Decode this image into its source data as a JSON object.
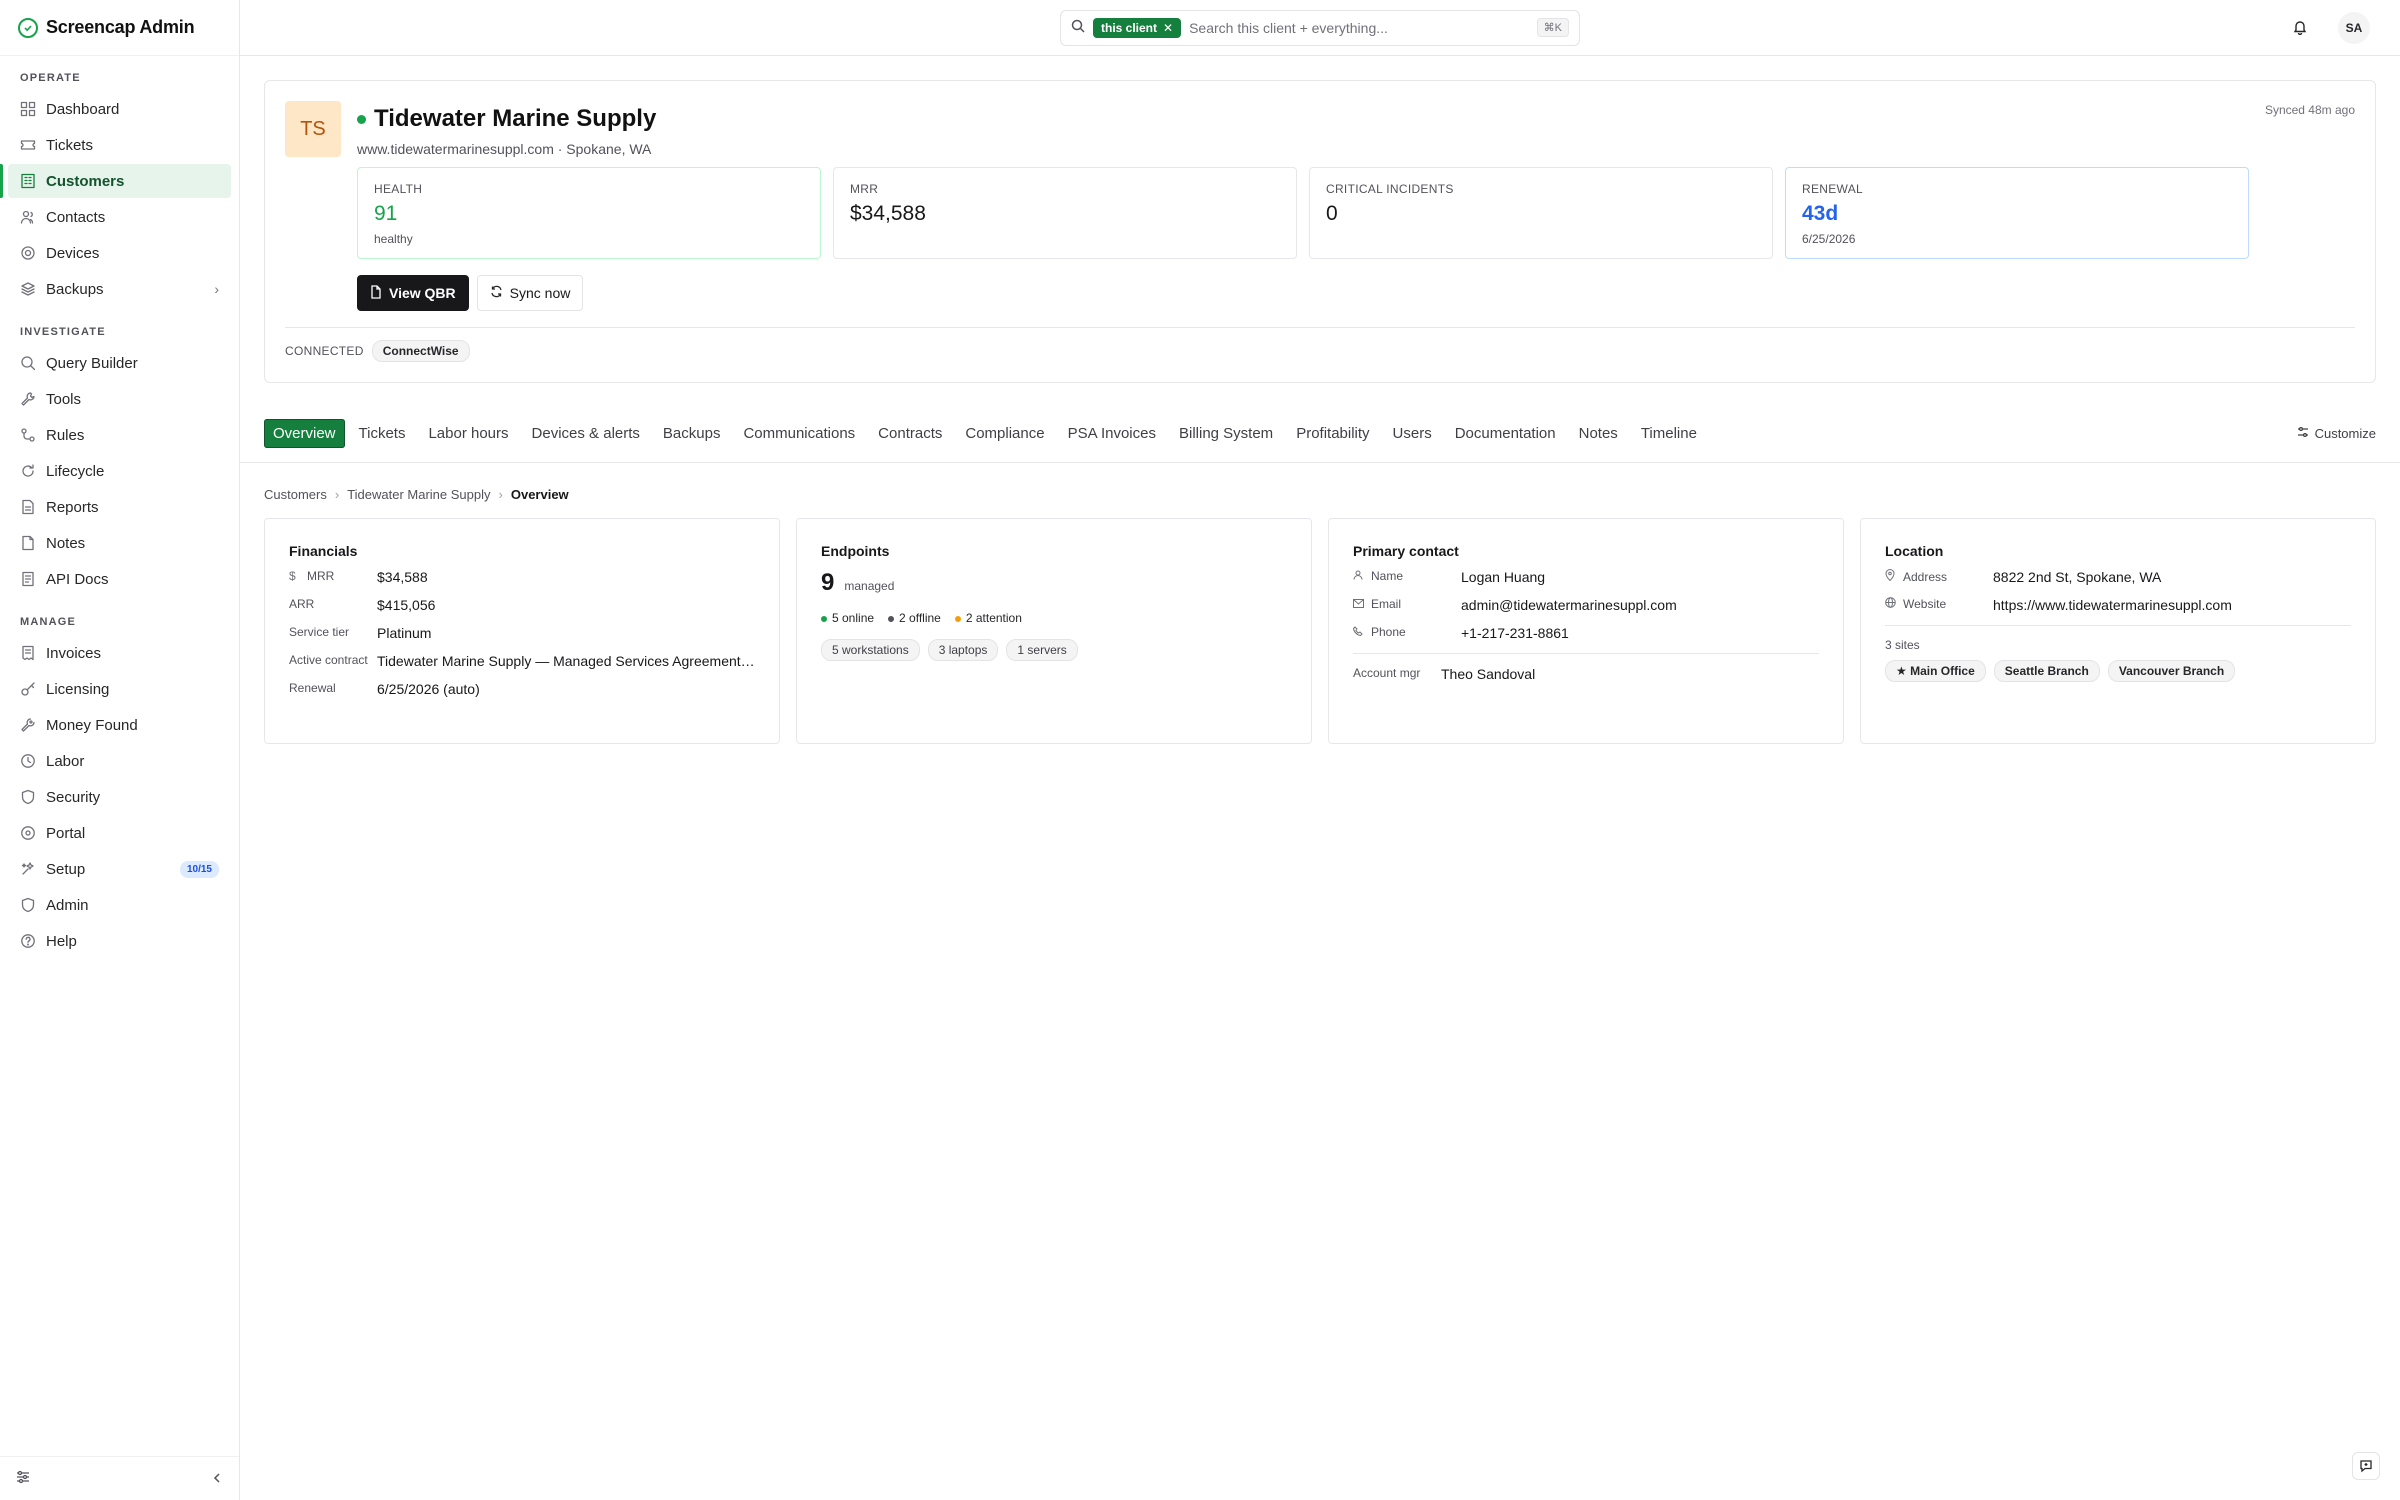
{
  "app": {
    "name": "Screencap Admin"
  },
  "sidebar": {
    "sections": [
      {
        "title": "OPERATE",
        "items": [
          {
            "label": "Dashboard",
            "icon": "dashboard-icon"
          },
          {
            "label": "Tickets",
            "icon": "ticket-icon"
          },
          {
            "label": "Customers",
            "icon": "building-icon",
            "active": true
          },
          {
            "label": "Contacts",
            "icon": "contacts-icon"
          },
          {
            "label": "Devices",
            "icon": "devices-icon"
          },
          {
            "label": "Backups",
            "icon": "backup-icon",
            "expandable": true
          }
        ]
      },
      {
        "title": "INVESTIGATE",
        "items": [
          {
            "label": "Query Builder",
            "icon": "search-icon"
          },
          {
            "label": "Tools",
            "icon": "wrench-icon"
          },
          {
            "label": "Rules",
            "icon": "rules-icon"
          },
          {
            "label": "Lifecycle",
            "icon": "lifecycle-icon"
          },
          {
            "label": "Reports",
            "icon": "report-icon"
          },
          {
            "label": "Notes",
            "icon": "note-icon"
          },
          {
            "label": "API Docs",
            "icon": "doc-icon"
          }
        ]
      },
      {
        "title": "MANAGE",
        "items": [
          {
            "label": "Invoices",
            "icon": "invoice-icon"
          },
          {
            "label": "Licensing",
            "icon": "key-icon"
          },
          {
            "label": "Money Found",
            "icon": "money-icon"
          },
          {
            "label": "Labor",
            "icon": "clock-icon"
          },
          {
            "label": "Security",
            "icon": "shield-icon"
          },
          {
            "label": "Portal",
            "icon": "portal-icon"
          },
          {
            "label": "Setup",
            "icon": "setup-icon",
            "badge": "10/15"
          },
          {
            "label": "Admin",
            "icon": "admin-shield-icon"
          },
          {
            "label": "Help",
            "icon": "help-icon"
          }
        ]
      }
    ]
  },
  "topbar": {
    "scope_chip": "this client",
    "search_placeholder": "Search this client + everything...",
    "shortcut": "⌘K",
    "user_initials": "SA"
  },
  "client": {
    "initials": "TS",
    "name": "Tidewater Marine Supply",
    "subtitle": "www.tidewatermarinesuppl.com · Spokane, WA",
    "synced": "Synced 48m ago",
    "metrics": [
      {
        "label": "HEALTH",
        "value": "91",
        "sub": "healthy",
        "tone": "green"
      },
      {
        "label": "MRR",
        "value": "$34,588",
        "sub": "",
        "tone": ""
      },
      {
        "label": "CRITICAL INCIDENTS",
        "value": "0",
        "sub": "",
        "tone": ""
      },
      {
        "label": "RENEWAL",
        "value": "43d",
        "sub": "6/25/2026",
        "tone": "blue"
      }
    ],
    "actions": {
      "qbr": "View QBR",
      "sync": "Sync now"
    },
    "connected_label": "CONNECTED",
    "connected_integration": "ConnectWise"
  },
  "tabs": [
    "Overview",
    "Tickets",
    "Labor hours",
    "Devices & alerts",
    "Backups",
    "Communications",
    "Contracts",
    "Compliance",
    "PSA Invoices",
    "Billing System",
    "Profitability",
    "Users",
    "Documentation",
    "Notes",
    "Timeline"
  ],
  "customize_label": "Customize",
  "breadcrumb": [
    "Customers",
    "Tidewater Marine Supply",
    "Overview"
  ],
  "financials": {
    "title": "Financials",
    "rows": [
      {
        "k": "MRR",
        "v": "$34,588"
      },
      {
        "k": "ARR",
        "v": "$415,056"
      },
      {
        "k": "Service tier",
        "v": "Platinum"
      },
      {
        "k": "Active contract",
        "v": "Tidewater Marine Supply — Managed Services Agreement ..."
      },
      {
        "k": "Renewal",
        "v": "6/25/2026 (auto)"
      }
    ]
  },
  "endpoints": {
    "title": "Endpoints",
    "count": "9",
    "unit": "managed",
    "online": "5 online",
    "offline": "2 offline",
    "attention": "2 attention",
    "tags": [
      "5 workstations",
      "3 laptops",
      "1 servers"
    ]
  },
  "contact": {
    "title": "Primary contact",
    "name_label": "Name",
    "name": "Logan Huang",
    "email_label": "Email",
    "email": "admin@tidewatermarinesuppl.com",
    "phone_label": "Phone",
    "phone": "+1-217-231-8861",
    "mgr_label": "Account mgr",
    "mgr": "Theo Sandoval"
  },
  "location": {
    "title": "Location",
    "address_label": "Address",
    "address": "8822 2nd St, Spokane, WA",
    "website_label": "Website",
    "website": "https://www.tidewatermarinesuppl.com",
    "sites_label": "3 sites",
    "sites": [
      "★ Main Office",
      "Seattle Branch",
      "Vancouver Branch"
    ]
  }
}
